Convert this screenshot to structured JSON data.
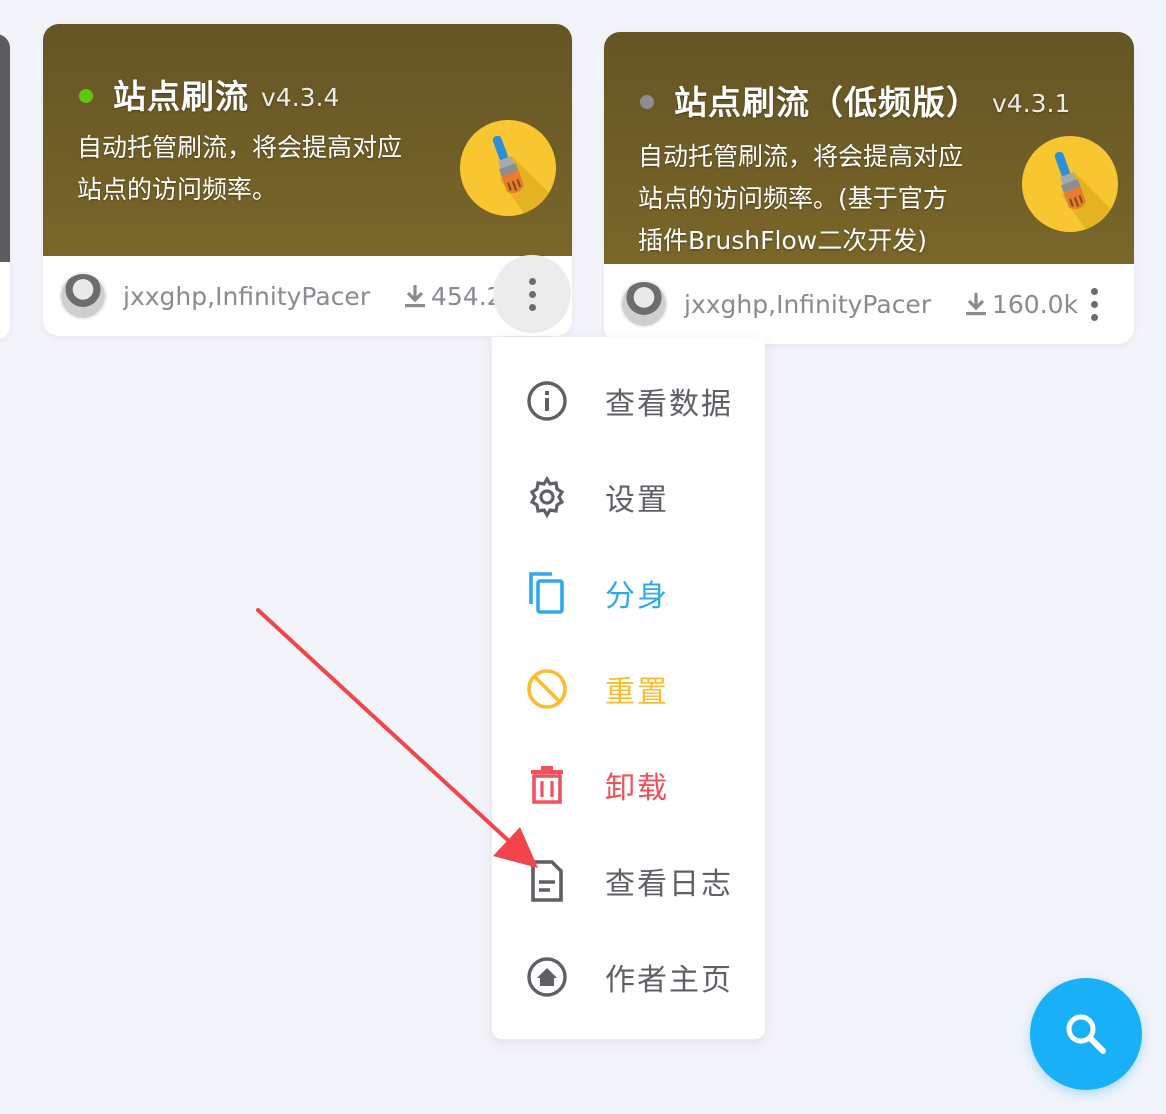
{
  "colors": {
    "active_dot": "#63c60d",
    "inactive_dot": "#8d8d92",
    "fab": "#1ab0f7",
    "clone": "#2ea9f0",
    "reset": "#fbbc2e",
    "uninstall": "#f0515c",
    "default_menu": "#5f5f66"
  },
  "cards": [
    {
      "name": "站点刷流",
      "version": "v4.3.4",
      "status": "enabled",
      "desc_lines": [
        "自动托管刷流，将会提高对应",
        "站点的访问频率。"
      ],
      "author": "jxxghp,InfinityPacer",
      "downloads": "454.2k",
      "icon": "paintbrush-icon"
    },
    {
      "name": "站点刷流（低频版）",
      "version": "v4.3.1",
      "status": "disabled",
      "desc_lines": [
        "自动托管刷流，将会提高对应",
        "站点的访问频率。(基于官方",
        "插件BrushFlow二次开发)"
      ],
      "author": "jxxghp,InfinityPacer",
      "downloads": "160.0k",
      "icon": "paintbrush-icon"
    }
  ],
  "menu": {
    "items": [
      {
        "label": "查看数据",
        "icon": "info-icon"
      },
      {
        "label": "设置",
        "icon": "gear-icon"
      },
      {
        "label": "分身",
        "icon": "copy-icon"
      },
      {
        "label": "重置",
        "icon": "block-icon"
      },
      {
        "label": "卸载",
        "icon": "trash-icon"
      },
      {
        "label": "查看日志",
        "icon": "file-text-icon"
      },
      {
        "label": "作者主页",
        "icon": "home-icon"
      }
    ]
  },
  "fab": {
    "icon": "search-icon"
  }
}
